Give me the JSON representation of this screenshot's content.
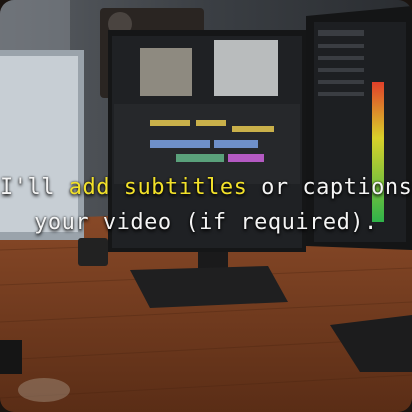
{
  "caption": {
    "line1_before": "I'll ",
    "line1_highlight": "add subtitles",
    "line1_after": " or captions in",
    "line2": "your video (if required)."
  },
  "colors": {
    "caption_text": "#f4f4f4",
    "highlight": "#f2e12a",
    "wall": "#3a3f45",
    "desk": "#7a3f22"
  }
}
